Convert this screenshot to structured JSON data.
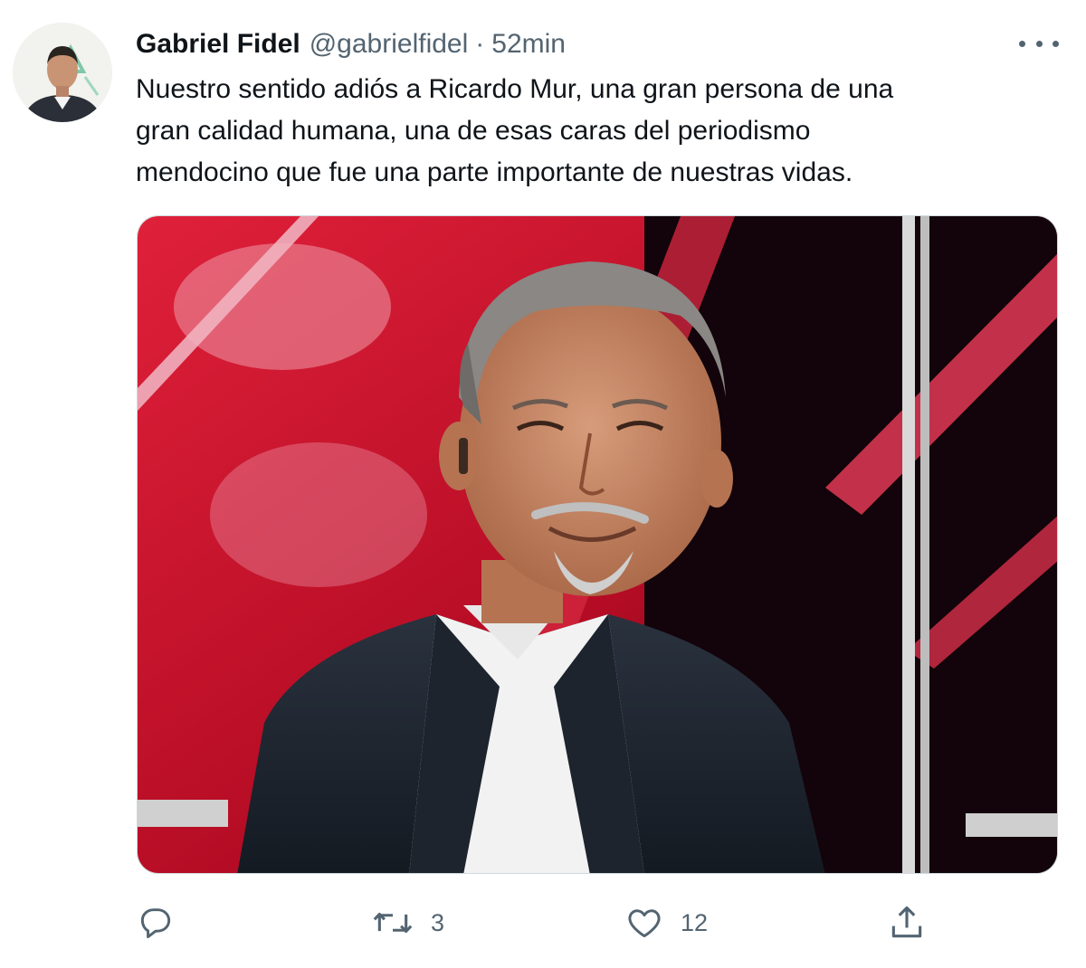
{
  "author": {
    "display_name": "Gabriel Fidel",
    "handle": "@gabrielfidel",
    "separator": "·",
    "time": "52min",
    "avatar_icon": "profile-avatar"
  },
  "tweet": {
    "text": "Nuestro sentido adiós a Ricardo Mur, una gran persona de una\ngran calidad humana,  una de esas caras del periodismo\nmendocino que fue una parte importante de nuestras vidas.",
    "media_icon": "photo-man-smiling-in-tv-studio"
  },
  "actions": {
    "reply": {
      "icon": "reply-icon",
      "count": ""
    },
    "retweet": {
      "icon": "retweet-icon",
      "count": "3"
    },
    "like": {
      "icon": "heart-icon",
      "count": "12"
    },
    "share": {
      "icon": "share-icon"
    }
  },
  "colors": {
    "text_primary": "#0f1419",
    "text_secondary": "#536471",
    "studio_red": "#c8102e",
    "studio_dark": "#1a0508"
  }
}
